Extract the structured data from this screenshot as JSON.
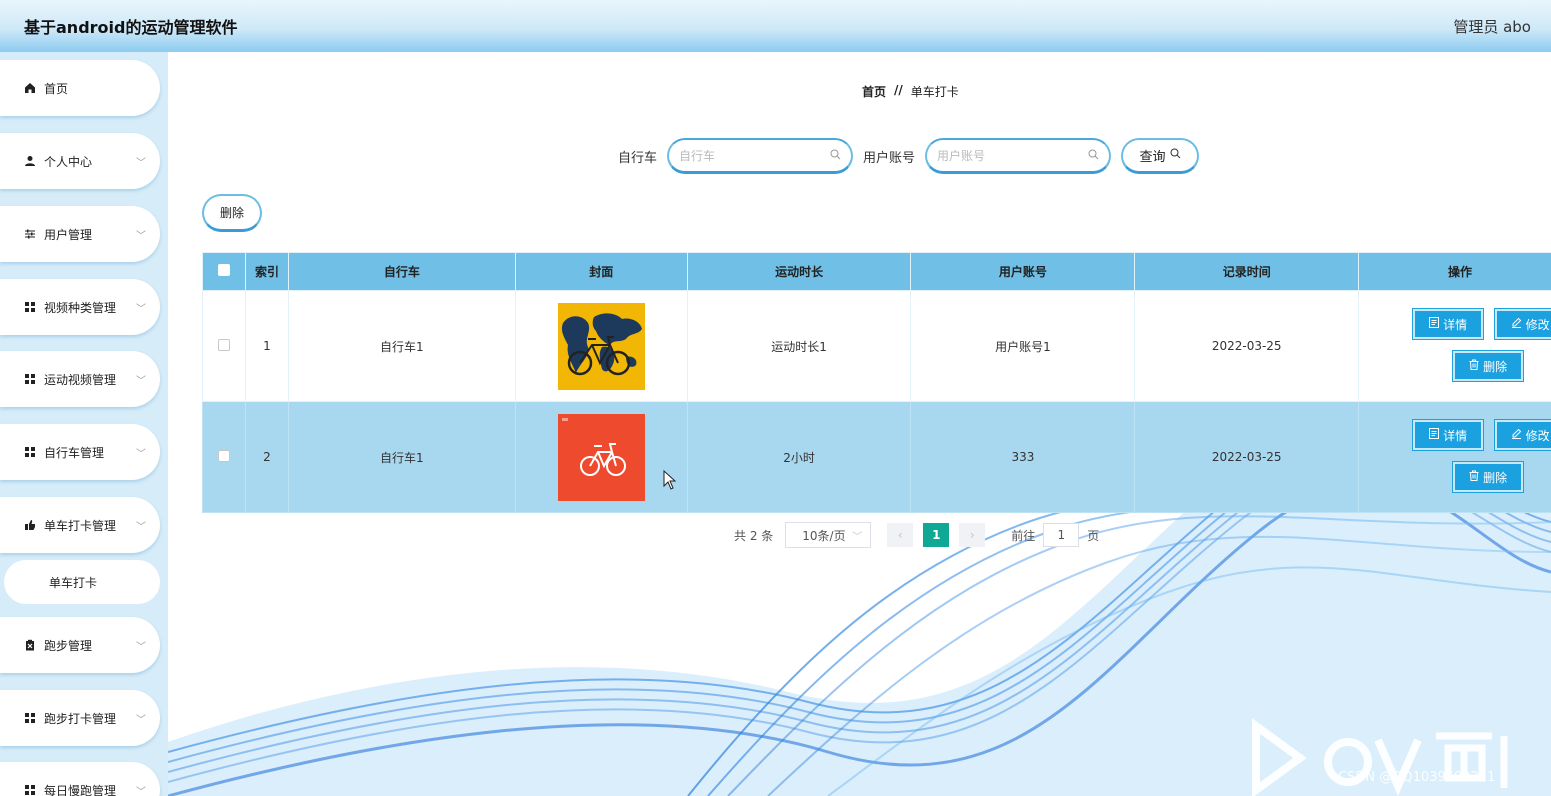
{
  "header": {
    "title": "基于android的运动管理软件",
    "user": "管理员 abo"
  },
  "sidebar": {
    "items": [
      {
        "label": "首页",
        "icon": "home-icon",
        "has_chevron": false
      },
      {
        "label": "个人中心",
        "icon": "user-icon",
        "has_chevron": true
      },
      {
        "label": "用户管理",
        "icon": "sliders-icon",
        "has_chevron": true
      },
      {
        "label": "视频种类管理",
        "icon": "grid-icon",
        "has_chevron": true
      },
      {
        "label": "运动视频管理",
        "icon": "grid-icon",
        "has_chevron": true
      },
      {
        "label": "自行车管理",
        "icon": "grid-icon",
        "has_chevron": true
      },
      {
        "label": "单车打卡管理",
        "icon": "thumb-icon",
        "has_chevron": true
      },
      {
        "label": "跑步管理",
        "icon": "clipboard-icon",
        "has_chevron": true
      },
      {
        "label": "跑步打卡管理",
        "icon": "grid-icon",
        "has_chevron": true
      },
      {
        "label": "每日慢跑管理",
        "icon": "grid-icon",
        "has_chevron": true
      }
    ],
    "submenu": {
      "label": "单车打卡"
    }
  },
  "breadcrumb": {
    "home": "首页",
    "separator": "//",
    "current": "单车打卡"
  },
  "search": {
    "bike_label": "自行车",
    "bike_placeholder": "自行车",
    "account_label": "用户账号",
    "account_placeholder": "用户账号",
    "query_label": "查询"
  },
  "toolbar": {
    "delete_label": "删除"
  },
  "table": {
    "columns": [
      "索引",
      "自行车",
      "封面",
      "运动时长",
      "用户账号",
      "记录时间",
      "操作"
    ],
    "rows": [
      {
        "index": "1",
        "bike": "自行车1",
        "cover": "world-map-bicycle",
        "duration": "运动时长1",
        "account": "用户账号1",
        "time": "2022-03-25"
      },
      {
        "index": "2",
        "bike": "自行车1",
        "cover": "red-bicycle",
        "duration": "2小时",
        "account": "333",
        "time": "2022-03-25"
      }
    ],
    "actions": {
      "detail": "详情",
      "edit": "修改",
      "delete": "删除"
    }
  },
  "pagination": {
    "total": "共 2 条",
    "page_size": "10条/页",
    "current_page": "1",
    "goto_prefix": "前往",
    "goto_value": "1",
    "goto_suffix": "页"
  },
  "watermark": "CSDN @QQ1039692211",
  "colors": {
    "header_gradient_bottom": "#8ccbf0",
    "table_header": "#6fbfe6",
    "row_highlight": "#a8d8ef",
    "action_button": "#1ba0e0",
    "pagination_active": "#0fa894"
  }
}
